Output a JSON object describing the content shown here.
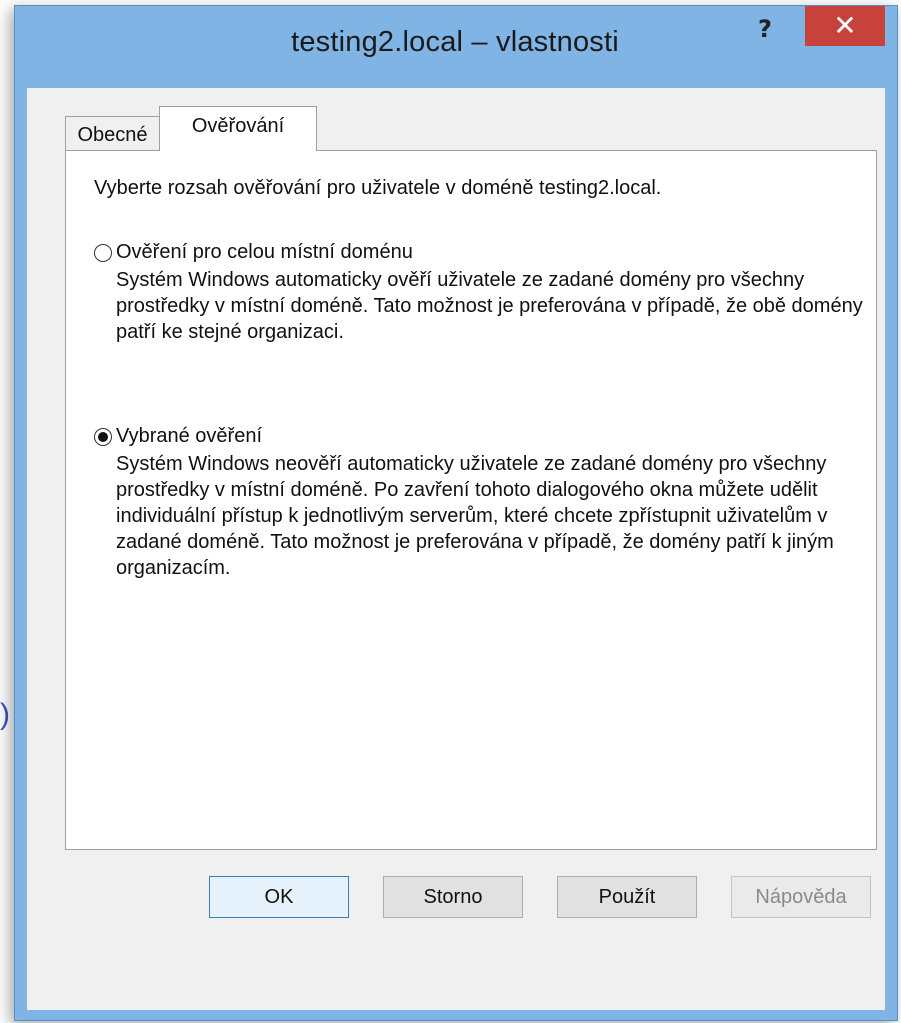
{
  "background_glyph": ")",
  "window": {
    "title": "testing2.local – vlastnosti",
    "help_glyph": "?",
    "close_glyph": "✕"
  },
  "tabs": [
    {
      "label": "Obecné",
      "active": false
    },
    {
      "label": "Ověřování",
      "active": true
    }
  ],
  "panel": {
    "intro": "Vyberte rozsah ověřování pro uživatele v doméně testing2.local.",
    "options": [
      {
        "label": "Ověření pro celou místní doménu",
        "selected": false,
        "description": "Systém Windows automaticky ověří uživatele ze zadané domény pro všechny prostředky v místní doméně. Tato možnost je preferována v případě, že obě domény patří ke stejné organizaci."
      },
      {
        "label": "Vybrané ověření",
        "selected": true,
        "description": "Systém Windows neověří automaticky uživatele ze zadané domény pro všechny prostředky v místní doméně. Po zavření tohoto dialogového okna můžete udělit individuální přístup k jednotlivým serverům, které chcete zpřístupnit uživatelům v zadané doméně. Tato možnost je preferována v případě, že domény patří k jiným organizacím."
      }
    ]
  },
  "buttons": {
    "ok": "OK",
    "cancel": "Storno",
    "apply": "Použít",
    "help": "Nápověda",
    "help_enabled": false
  },
  "colors": {
    "frame": "#7fb4e4",
    "close": "#c7423b",
    "client": "#f0f0f0"
  }
}
